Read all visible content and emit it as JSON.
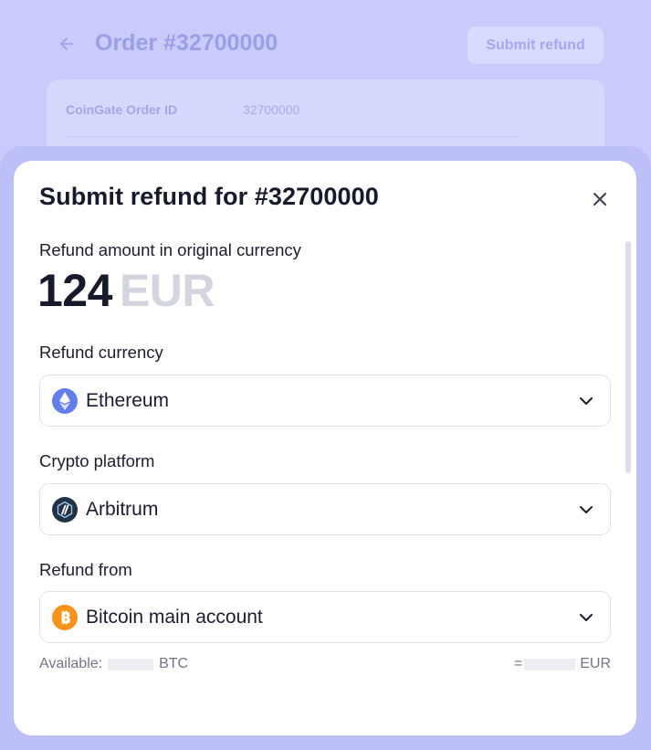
{
  "background": {
    "title": "Order #32700000",
    "submit_label": "Submit refund",
    "details": {
      "label": "CoinGate Order ID",
      "value": "32700000"
    }
  },
  "modal": {
    "title": "Submit refund for #32700000",
    "amount_label": "Refund amount in original currency",
    "amount_value": "124",
    "amount_currency": "EUR",
    "refund_currency": {
      "label": "Refund currency",
      "value": "Ethereum",
      "icon": "ethereum-icon",
      "icon_color": "#627EEA"
    },
    "crypto_platform": {
      "label": "Crypto platform",
      "value": "Arbitrum",
      "icon": "arbitrum-icon",
      "icon_color": "#213147"
    },
    "refund_from": {
      "label": "Refund from",
      "value": "Bitcoin main account",
      "icon": "bitcoin-icon",
      "icon_color": "#F7931A"
    },
    "available": {
      "prefix": "Available:",
      "unit": "BTC"
    },
    "equivalent": {
      "prefix": "=",
      "unit": "EUR"
    }
  },
  "colors": {
    "backdrop": "#c9cbfb",
    "accent": "#627EEA"
  }
}
